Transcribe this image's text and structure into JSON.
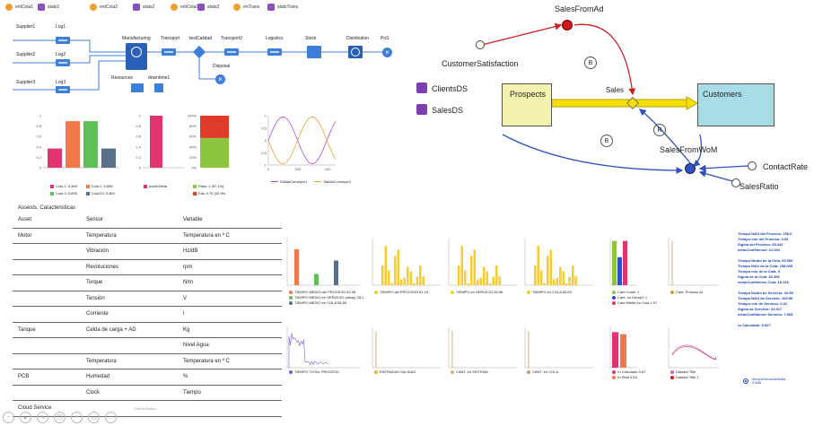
{
  "process": {
    "chips": [
      "entCola1",
      "stats1",
      "entCola2",
      "stats2",
      "entCola3",
      "stats3",
      "enTrans",
      "statsTrans"
    ],
    "blocks": {
      "supplier1": "Supplier1",
      "log1": "Log1",
      "supplier2": "Supplier2",
      "log2": "Log2",
      "supplier3": "Supplier3",
      "log3": "Log3",
      "manufacturing": "Manufacturing",
      "transport": "Transport",
      "test": "testCalidad",
      "transport2": "Transport2",
      "logistics": "Logistics",
      "stock": "Stock",
      "distribution": "Distribution",
      "pos": "PoS",
      "disposal": "Disposal",
      "resources": "Resources",
      "downtime": "downtime1"
    },
    "queue_legend": [
      "Cola 1: 0.369",
      "Cola 2: 0.895",
      "Cola 3: 0.895",
      "ColaTO: 0.369"
    ],
    "pos_legend": "posHUMda",
    "pass_legend": [
      "Pass: 1 (57.1%)",
      "Fail: 0.75 (42.9%"
    ],
    "sine_legend": [
      "SalidaConveyor1",
      "SalidaConveyor2"
    ],
    "queue_chart": {
      "ticks": [
        "1",
        "0.8",
        "0.6",
        "0.4",
        "0.2",
        "0"
      ],
      "values": [
        0.369,
        0.895,
        0.895,
        0.369
      ],
      "colors": [
        "#e0336f",
        "#f07a4a",
        "#5fc05a",
        "#5a6f8a"
      ]
    },
    "pos_chart": {
      "ticks": [
        "1",
        "0.8",
        "0.6",
        "0.4",
        "0.2",
        "0"
      ],
      "value": 1
    },
    "pass_chart": {
      "ticks": [
        "100%",
        "80%",
        "60%",
        "40%",
        "20%",
        "0%"
      ],
      "pass_pct": 57.1
    },
    "sine_chart": {
      "yticks": [
        "1",
        "0.5",
        "0",
        "-0.5",
        "-1"
      ],
      "xticks": [
        "0",
        "200",
        "400"
      ]
    }
  },
  "sd": {
    "sales_from_ad": "SalesFromAd",
    "customer_satisfaction": "CustomerSatisfaction",
    "clients_ds": "ClientsDS",
    "sales_ds": "SalesDS",
    "prospects": "Prospects",
    "sales": "Sales",
    "customers": "Customers",
    "loop_b1": "B",
    "loop_r": "R",
    "loop_b2": "B",
    "sales_from_wom": "SalesFromWoM",
    "contact_rate": "ContactRate",
    "sales_ratio": "SalesRatio"
  },
  "table": {
    "title": "Assests. Caracteristicas",
    "headers": [
      "Asset",
      "Sensor",
      "Variable"
    ],
    "rows": [
      [
        "Motor",
        "Temperatura",
        "Temperatura en º C"
      ],
      [
        "",
        "Vibración",
        "Hz/dB"
      ],
      [
        "",
        "Revoluciones",
        "rpm"
      ],
      [
        "",
        "Torque",
        "N/m"
      ],
      [
        "",
        "Tensión",
        "V"
      ],
      [
        "",
        "Corriente",
        "i"
      ],
      [
        "Tanque",
        "Celda de carga + AD",
        "Kg"
      ],
      [
        "",
        "",
        "Nivel Agua"
      ],
      [
        "",
        "Temperatura",
        "Temperatura en º C"
      ],
      [
        "PCB",
        "Humedad",
        "%"
      ],
      [
        "",
        "Clock",
        "Tiempo"
      ],
      [
        "Cloud Service",
        "",
        ""
      ]
    ],
    "footer": "Puerta Banco"
  },
  "dashboard": {
    "top_legends": [
      [
        "TIEMPO MEDIO del PROCESO 82.06",
        "TIEMPO MEDIO en SERVICIO (delay) 28.1",
        "TIEMPO MEDIO en COLA 58.55"
      ],
      [
        "TIEMPO del PROCESO 61.15"
      ],
      [
        "TIEMPO en SERVICIO 28.56"
      ],
      [
        "TIEMPO en COLA 60.63"
      ],
      [
        "Cant Cola0: 2",
        "Cant. en Delay0: 1",
        "Cant Media en Cola 1.97"
      ],
      [
        "Cant. Proceso Ar"
      ]
    ],
    "bottom_legends": [
      [
        "TIEMPO TOTAL PROCESO"
      ],
      [
        "ENTRADAS-SALIDAS"
      ],
      [
        "CANT. en SISTEMA"
      ],
      [
        "CANT. en COLA"
      ],
      [
        "rn Calculado 0.67",
        "rn Real 0.63"
      ],
      [
        "Dataset Title",
        "Dataset Title 1"
      ]
    ],
    "stats": [
      "Tiempo MAX del Proceso: 156.0",
      "Tiempo min del Proceso: 0.92",
      "Sigma del Proceso: 65.342",
      "meanConfidence: 21.064",
      "",
      "Tiempo Medio de la Cola: 60.006",
      "Tiempo MAX de la Cola: 158.095",
      "Tiempo min de la Cola: 0",
      "Sigma de la Cola: 60.396",
      "meanConfidence Cola: 18.133",
      "",
      "Tiempo Medio de Servicio: 20.55",
      "Tiempo MAX de Servicio: 105.56",
      "Tiempo min de Servicio: 0.02",
      "Sigma de Servicio: 24.917",
      "meanConfidence Servicio: 7.565",
      "",
      "ro Calculado: 0.667"
    ],
    "radio_label": "tiempoServicioMedia",
    "radio_sub": "0.566"
  },
  "toolbar": {
    "buttons": [
      "zoom-out",
      "play",
      "edit",
      "copy",
      "zoom-in",
      "screen",
      "more"
    ]
  }
}
